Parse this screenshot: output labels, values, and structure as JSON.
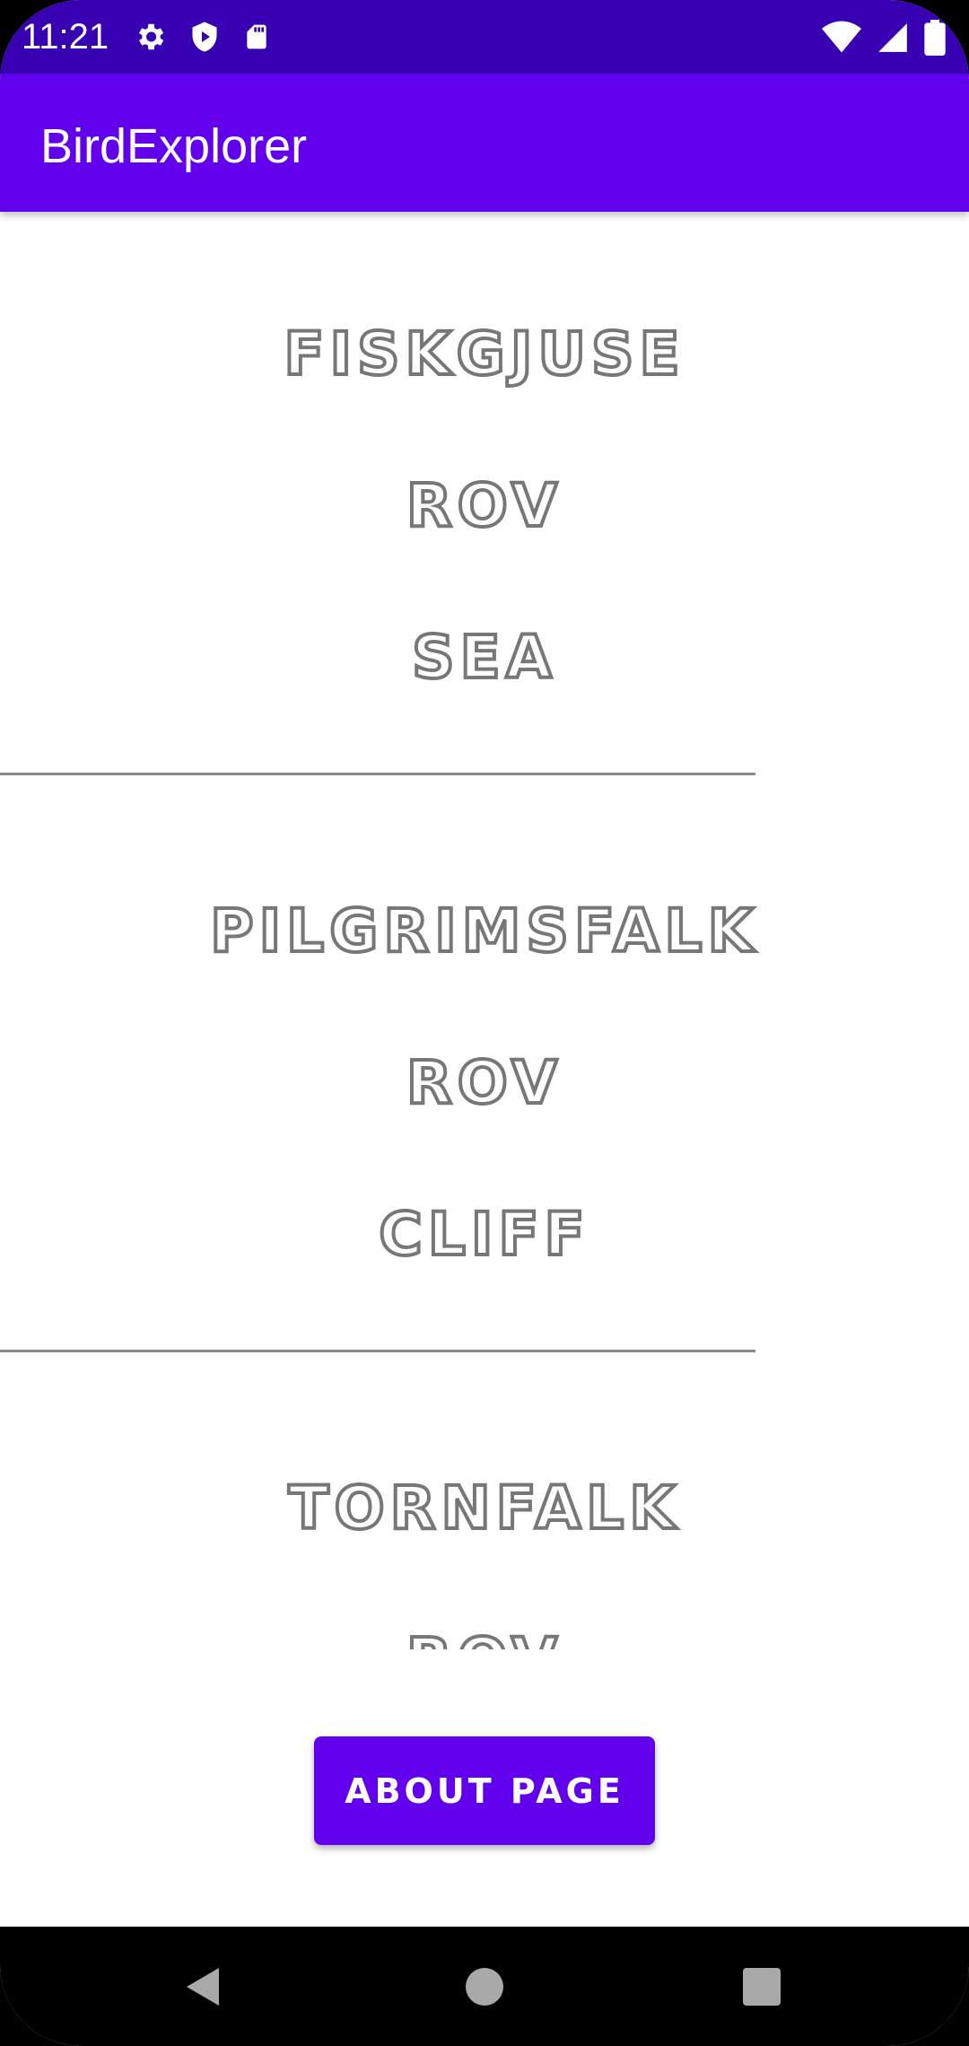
{
  "status_bar": {
    "time": "11:21",
    "icons_left": [
      "gear-icon",
      "shield-play-icon",
      "sd-card-icon"
    ],
    "icons_right": [
      "wifi-icon",
      "cell-signal-icon",
      "battery-icon"
    ],
    "color": "#3700b3"
  },
  "app_bar": {
    "title": "BirdExplorer",
    "color": "#6200ee"
  },
  "birds": [
    {
      "name": "FISKGJUSE",
      "category": "ROV",
      "habitat": "SEA"
    },
    {
      "name": "PILGRIMSFALK",
      "category": "ROV",
      "habitat": "CLIFF"
    },
    {
      "name": "TORNFALK",
      "category": "ROV",
      "habitat": ""
    }
  ],
  "about_button": {
    "label": "ABOUT PAGE"
  },
  "nav_bar": {
    "icons": [
      "back-icon",
      "home-icon",
      "recents-icon"
    ]
  }
}
